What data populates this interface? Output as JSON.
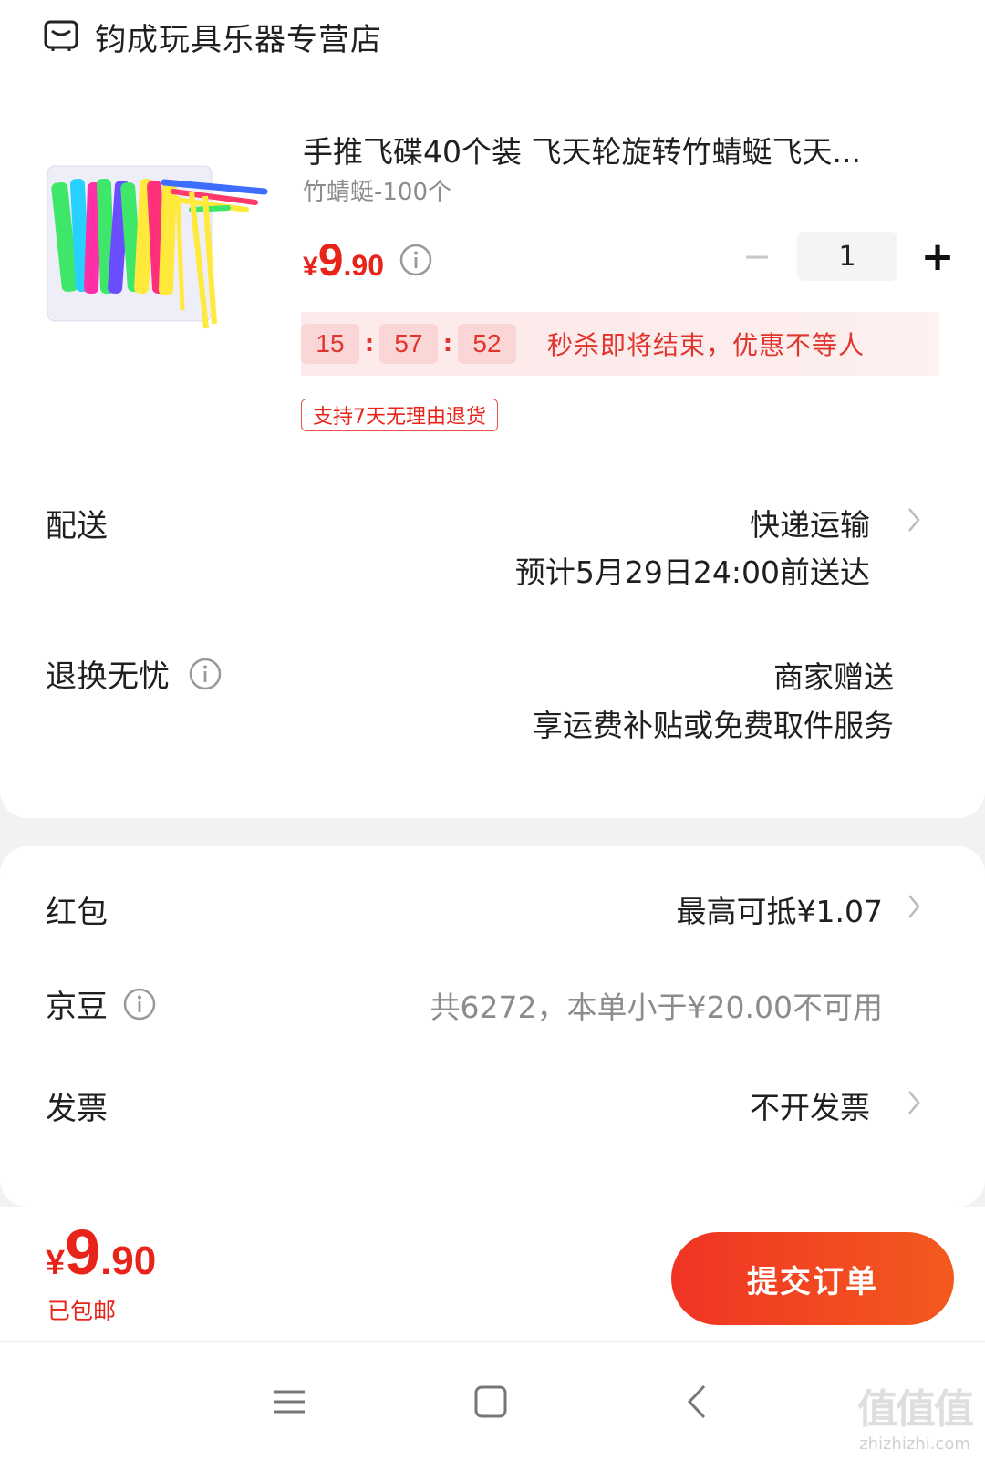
{
  "store": {
    "name": "钧成玩具乐器专营店",
    "icon": "store-icon"
  },
  "product": {
    "title": "手推飞碟40个装 飞天轮旋转竹蜻蜓飞天...",
    "spec": "竹蜻蜓-100个",
    "price_yen": "¥",
    "price_int": "9",
    "price_dec": ".90",
    "quantity": "1",
    "minus_label": "−",
    "plus_label": "+",
    "countdown": {
      "hours": "15",
      "minutes": "57",
      "seconds": "52",
      "sep": ":",
      "text": "秒杀即将结束，优惠不等人"
    },
    "return_badge": "支持7天无理由退货"
  },
  "delivery": {
    "label": "配送",
    "method": "快递运输",
    "eta": "预计5月29日24:00前送达"
  },
  "returns": {
    "label": "退换无忧",
    "value": "商家赠送",
    "desc": "享运费补贴或免费取件服务"
  },
  "red_packet": {
    "label": "红包",
    "value": "最高可抵¥1.07"
  },
  "jd_beans": {
    "label": "京豆",
    "value": "共6272，本单小于¥20.00不可用"
  },
  "invoice": {
    "label": "发票",
    "value": "不开发票"
  },
  "footer": {
    "total_yen": "¥",
    "total_int": "9",
    "total_dec": ".90",
    "shipping": "已包邮",
    "submit": "提交订单"
  },
  "watermark": {
    "big": "值值值",
    "small": "zhizhizhi.com"
  },
  "colors": {
    "accent": "#e8241a",
    "button_start": "#f03424",
    "button_end": "#f35a1e"
  }
}
